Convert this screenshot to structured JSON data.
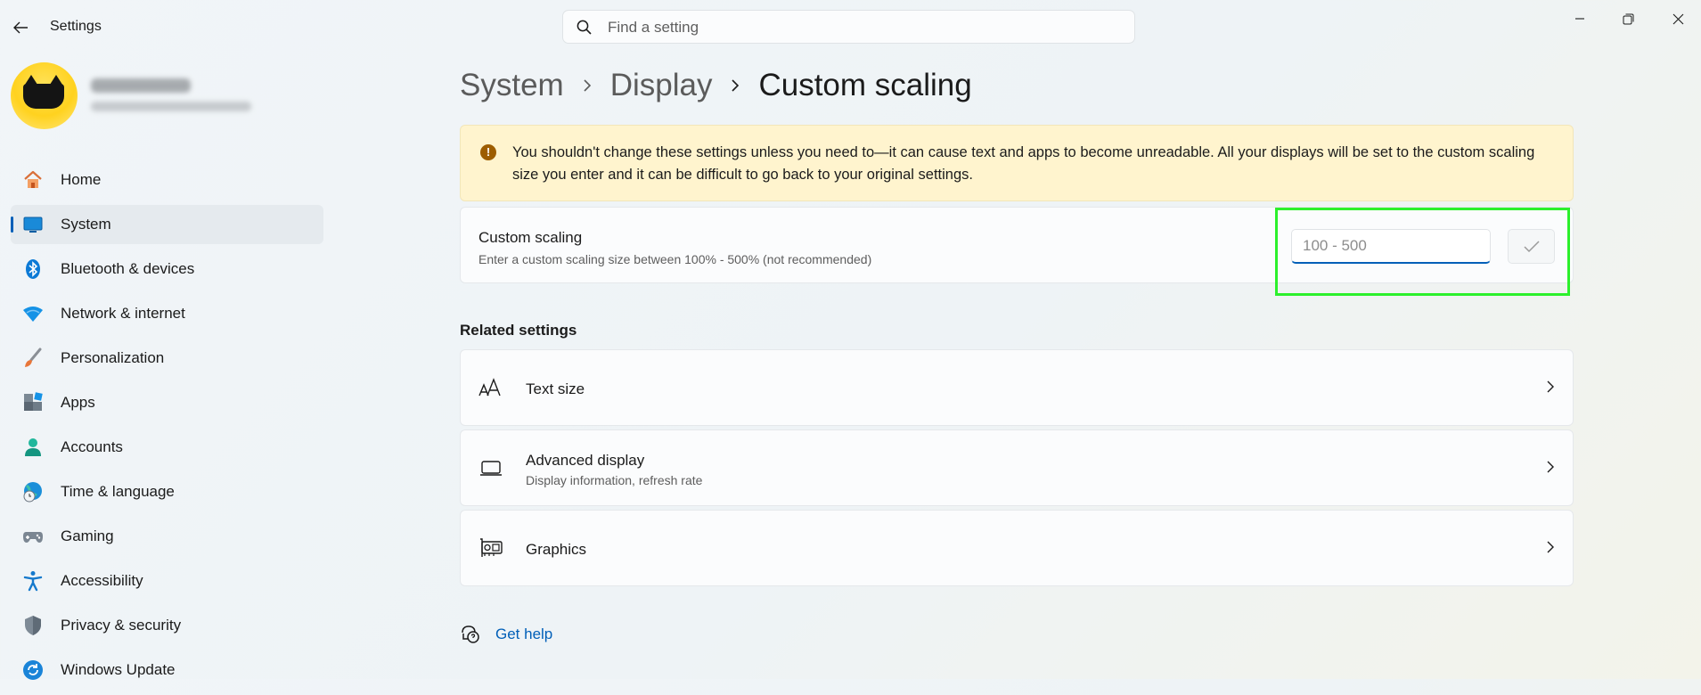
{
  "window": {
    "title": "Settings",
    "controls": [
      "minimize-icon",
      "restore-icon",
      "close-icon"
    ]
  },
  "search": {
    "placeholder": "Find a setting"
  },
  "sidebar": {
    "items": [
      {
        "label": "Home",
        "icon": "home-icon"
      },
      {
        "label": "System",
        "icon": "system-icon",
        "selected": true
      },
      {
        "label": "Bluetooth & devices",
        "icon": "bluetooth-icon"
      },
      {
        "label": "Network & internet",
        "icon": "wifi-icon"
      },
      {
        "label": "Personalization",
        "icon": "brush-icon"
      },
      {
        "label": "Apps",
        "icon": "apps-icon"
      },
      {
        "label": "Accounts",
        "icon": "person-icon"
      },
      {
        "label": "Time & language",
        "icon": "globe-clock-icon"
      },
      {
        "label": "Gaming",
        "icon": "gamepad-icon"
      },
      {
        "label": "Accessibility",
        "icon": "accessibility-icon"
      },
      {
        "label": "Privacy & security",
        "icon": "shield-icon"
      },
      {
        "label": "Windows Update",
        "icon": "update-icon"
      }
    ]
  },
  "breadcrumb": {
    "items": [
      "System",
      "Display",
      "Custom scaling"
    ]
  },
  "warning": {
    "text": "You shouldn't change these settings unless you need to—it can cause text and apps to become unreadable. All your displays will be set to the custom scaling size you enter and it can be difficult to go back to your original settings."
  },
  "custom_scaling": {
    "title": "Custom scaling",
    "description": "Enter a custom scaling size between 100% - 500% (not recommended)",
    "input_placeholder": "100 - 500",
    "input_value": ""
  },
  "related": {
    "heading": "Related settings",
    "items": [
      {
        "title": "Text size",
        "description": "",
        "icon": "text-size-icon"
      },
      {
        "title": "Advanced display",
        "description": "Display information, refresh rate",
        "icon": "laptop-icon"
      },
      {
        "title": "Graphics",
        "description": "",
        "icon": "graphics-card-icon"
      }
    ]
  },
  "help": {
    "label": "Get help"
  },
  "colors": {
    "accent": "#005fb8",
    "warning_bg": "#fff4ce",
    "highlight": "#2cf02c"
  }
}
